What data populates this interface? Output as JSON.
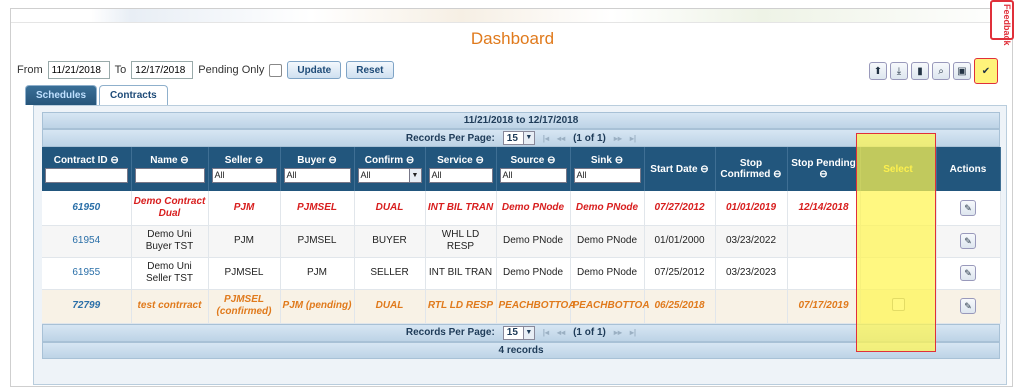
{
  "page": {
    "title": "Dashboard",
    "feedback_label": "Feedback"
  },
  "toolbar": {
    "from_label": "From",
    "from_value": "11/21/2018",
    "to_label": "To",
    "to_value": "12/17/2018",
    "pending_label": "Pending Only",
    "update_label": "Update",
    "reset_label": "Reset"
  },
  "icon_bar": [
    "arrow-up-icon",
    "download-icon",
    "document-icon",
    "search-icon",
    "save-icon",
    "check-icon"
  ],
  "tabs": [
    {
      "label": "Schedules",
      "active": true
    },
    {
      "label": "Contracts",
      "active": false
    }
  ],
  "grid": {
    "date_range": "11/21/2018 to 12/17/2018",
    "records_per_page_label": "Records Per Page:",
    "records_per_page": "15",
    "page_info": "(1 of 1)",
    "records_count": "4 records",
    "columns": [
      "Contract ID ⊖",
      "Name ⊖",
      "Seller ⊖",
      "Buyer ⊖",
      "Confirm ⊖",
      "Service ⊖",
      "Source ⊖",
      "Sink ⊖",
      "Start Date ⊖",
      "Stop Confirmed ⊖",
      "Stop Pending ⊖",
      "Select",
      "Actions"
    ],
    "filters": {
      "seller": "All",
      "buyer": "All",
      "confirm": "All",
      "service": "All",
      "source": "All",
      "sink": "All"
    },
    "rows": [
      {
        "id": "61950",
        "name": "Demo Contract Dual",
        "seller": "PJM",
        "buyer": "PJMSEL",
        "confirm": "DUAL",
        "service": "INT BIL TRAN",
        "source": "Demo PNode",
        "sink": "Demo PNode",
        "start": "07/27/2012",
        "stop_confirmed": "01/01/2019",
        "stop_pending": "12/14/2018",
        "style": "red"
      },
      {
        "id": "61954",
        "name": "Demo Uni Buyer TST",
        "seller": "PJM",
        "buyer": "PJMSEL",
        "confirm": "BUYER",
        "service": "WHL LD RESP",
        "source": "Demo PNode",
        "sink": "Demo PNode",
        "start": "01/01/2000",
        "stop_confirmed": "03/23/2022",
        "stop_pending": "",
        "style": "normal"
      },
      {
        "id": "61955",
        "name": "Demo Uni Seller TST",
        "seller": "PJMSEL",
        "buyer": "PJM",
        "confirm": "SELLER",
        "service": "INT BIL TRAN",
        "source": "Demo PNode",
        "sink": "Demo PNode",
        "start": "07/25/2012",
        "stop_confirmed": "03/23/2023",
        "stop_pending": "",
        "style": "normal"
      },
      {
        "id": "72799",
        "name": "test contrract",
        "seller": "PJMSEL (confirmed)",
        "buyer": "PJM (pending)",
        "confirm": "DUAL",
        "service": "RTL LD RESP",
        "source": "PEACHBOTTOA",
        "sink": "PEACHBOTTOA",
        "start": "06/25/2018",
        "stop_confirmed": "",
        "stop_pending": "07/17/2019",
        "style": "orange"
      }
    ]
  },
  "colors": {
    "header": "#22567d",
    "accent": "#e07a1c",
    "red": "#d81e1e",
    "highlight": "#fff37a"
  }
}
